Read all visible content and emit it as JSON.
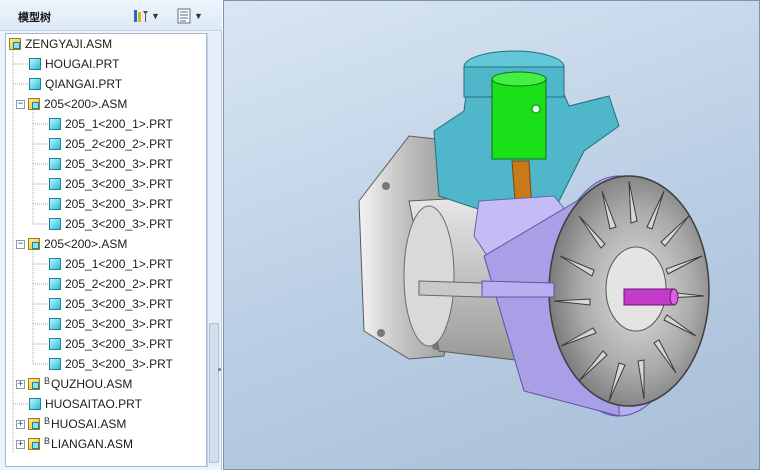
{
  "panel": {
    "title": "模型树",
    "settings_icon": "tree-settings-icon",
    "columns_icon": "tree-columns-icon"
  },
  "tree": {
    "items": [
      {
        "label": "ZENGYAJI.ASM",
        "icon": "assembly-icon",
        "expander": "",
        "tag": ""
      },
      {
        "label": "HOUGAI.PRT",
        "icon": "part-icon",
        "expander": "",
        "tag": ""
      },
      {
        "label": "QIANGAI.PRT",
        "icon": "part-icon",
        "expander": "",
        "tag": ""
      },
      {
        "label": "205<200>.ASM",
        "icon": "assembly-icon",
        "expander": "−",
        "tag": ""
      },
      {
        "label": "205_1<200_1>.PRT",
        "icon": "part-icon",
        "expander": "",
        "tag": ""
      },
      {
        "label": "205_2<200_2>.PRT",
        "icon": "part-icon",
        "expander": "",
        "tag": ""
      },
      {
        "label": "205_3<200_3>.PRT",
        "icon": "part-icon",
        "expander": "",
        "tag": ""
      },
      {
        "label": "205_3<200_3>.PRT",
        "icon": "part-icon",
        "expander": "",
        "tag": ""
      },
      {
        "label": "205_3<200_3>.PRT",
        "icon": "part-icon",
        "expander": "",
        "tag": ""
      },
      {
        "label": "205_3<200_3>.PRT",
        "icon": "part-icon",
        "expander": "",
        "tag": ""
      },
      {
        "label": "205<200>.ASM",
        "icon": "assembly-icon",
        "expander": "−",
        "tag": ""
      },
      {
        "label": "205_1<200_1>.PRT",
        "icon": "part-icon",
        "expander": "",
        "tag": ""
      },
      {
        "label": "205_2<200_2>.PRT",
        "icon": "part-icon",
        "expander": "",
        "tag": ""
      },
      {
        "label": "205_3<200_3>.PRT",
        "icon": "part-icon",
        "expander": "",
        "tag": ""
      },
      {
        "label": "205_3<200_3>.PRT",
        "icon": "part-icon",
        "expander": "",
        "tag": ""
      },
      {
        "label": "205_3<200_3>.PRT",
        "icon": "part-icon",
        "expander": "",
        "tag": ""
      },
      {
        "label": "205_3<200_3>.PRT",
        "icon": "part-icon",
        "expander": "",
        "tag": ""
      },
      {
        "label": "QUZHOU.ASM",
        "icon": "assembly-icon",
        "expander": "+",
        "tag": "B"
      },
      {
        "label": "HUOSAITAO.PRT",
        "icon": "part-icon",
        "expander": "",
        "tag": ""
      },
      {
        "label": "HUOSAI.ASM",
        "icon": "assembly-icon",
        "expander": "+",
        "tag": "B"
      },
      {
        "label": "LIANGAN.ASM",
        "icon": "assembly-icon",
        "expander": "+",
        "tag": "B"
      }
    ]
  },
  "viewport": {
    "model_icon": "3d-compressor-assembly",
    "colors": {
      "background": "#c6d6e8",
      "housing": "#c8c8c8",
      "cylinder": "#4fb7c9",
      "piston": "#19e019",
      "connecting_rod": "#c87a1a",
      "fan_cover": "#b8aef0",
      "shaft": "#c23cc9"
    }
  }
}
